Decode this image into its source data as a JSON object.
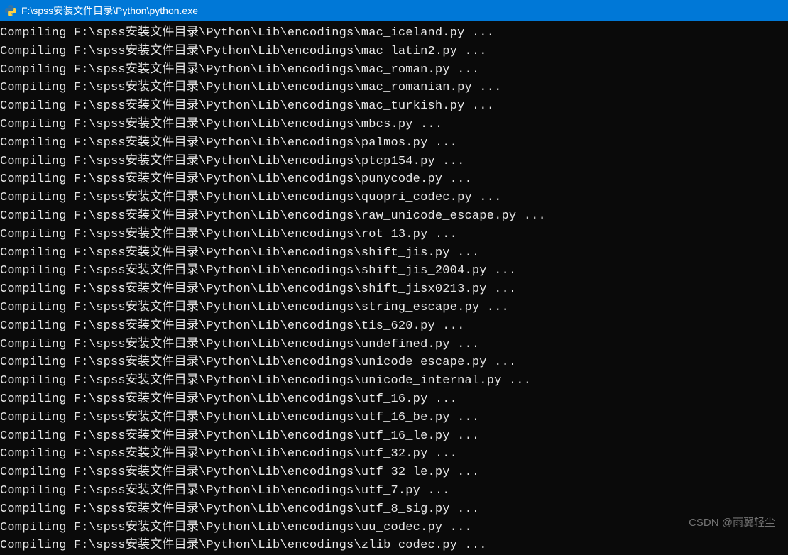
{
  "window": {
    "title": "F:\\spss安装文件目录\\Python\\python.exe"
  },
  "console": {
    "prefix": "Compiling ",
    "base_path": "F:\\spss安装文件目录\\Python\\Lib\\encodings\\",
    "suffix": " ...",
    "files": [
      "mac_iceland.py",
      "mac_latin2.py",
      "mac_roman.py",
      "mac_romanian.py",
      "mac_turkish.py",
      "mbcs.py",
      "palmos.py",
      "ptcp154.py",
      "punycode.py",
      "quopri_codec.py",
      "raw_unicode_escape.py",
      "rot_13.py",
      "shift_jis.py",
      "shift_jis_2004.py",
      "shift_jisx0213.py",
      "string_escape.py",
      "tis_620.py",
      "undefined.py",
      "unicode_escape.py",
      "unicode_internal.py",
      "utf_16.py",
      "utf_16_be.py",
      "utf_16_le.py",
      "utf_32.py",
      "utf_32_le.py",
      "utf_7.py",
      "utf_8_sig.py",
      "uu_codec.py",
      "zlib_codec.py"
    ]
  },
  "watermark": {
    "text": "CSDN @雨翼轻尘"
  }
}
